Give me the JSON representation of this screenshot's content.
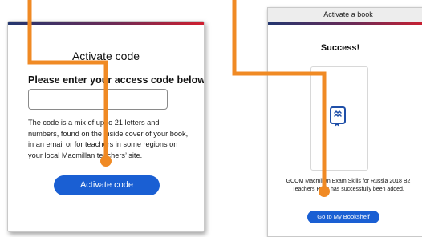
{
  "activate_code": {
    "title": "Activate code",
    "heading": "Please enter your access code below",
    "input_value": "",
    "help_text": "The code is a mix of up to 21 letters and numbers, found on the inside cover of your book, in an email or for teachers in some regions on your local Macmillan teachers’ site.",
    "button_label": "Activate code"
  },
  "activate_book": {
    "window_title": "Activate a book",
    "success_title": "Success!",
    "book_icon": "book-icon",
    "added_message": "GCOM Macmillan Exam Skills for Russia 2018 B2 Teachers Pack has successfully been added.",
    "button_label": "Go to My Bookshelf"
  },
  "colors": {
    "accent_blue": "#1a5fd3",
    "connector_orange": "#f08a24",
    "stripe_navy": "#23366f",
    "stripe_red": "#d01f2f"
  }
}
